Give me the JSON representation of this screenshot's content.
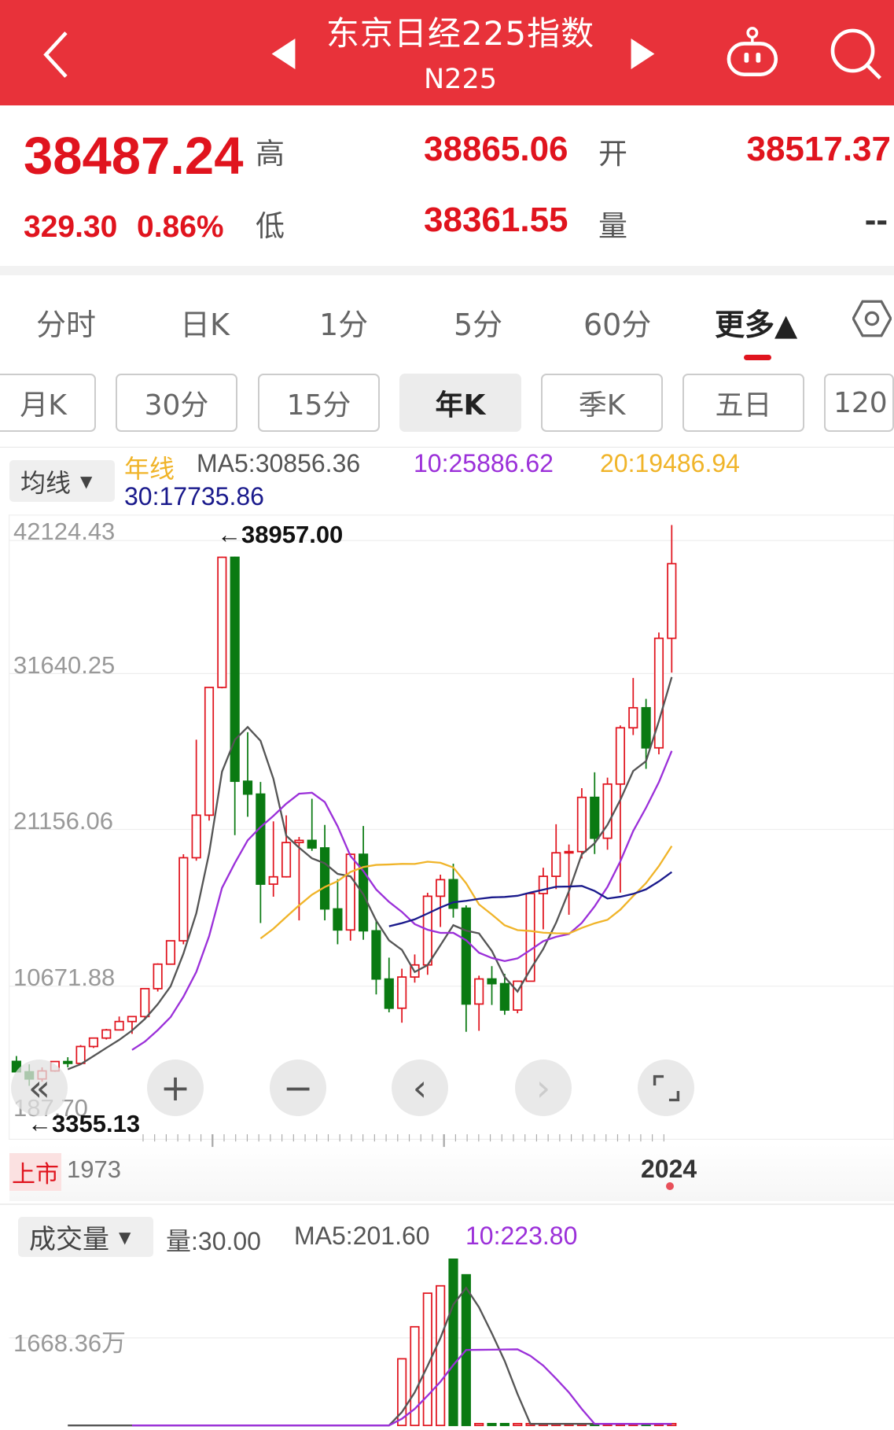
{
  "header": {
    "title": "东京日经225指数",
    "code": "N225"
  },
  "quote": {
    "price": "38487.24",
    "change": "329.30",
    "change_pct": "0.86%",
    "high_label": "高",
    "high": "38865.06",
    "open_label": "开",
    "open": "38517.37",
    "low_label": "低",
    "low": "38361.55",
    "vol_label": "量",
    "vol": "--"
  },
  "tabs": [
    {
      "label": "分时"
    },
    {
      "label": "日K"
    },
    {
      "label": "1分"
    },
    {
      "label": "5分"
    },
    {
      "label": "60分"
    },
    {
      "label": "更多▲"
    }
  ],
  "periods": [
    {
      "label": "月K"
    },
    {
      "label": "30分"
    },
    {
      "label": "15分"
    },
    {
      "label": "年K"
    },
    {
      "label": "季K"
    },
    {
      "label": "五日"
    },
    {
      "label": "120"
    }
  ],
  "ma_legend": {
    "selector": "均线",
    "type": "年线",
    "ma5": "MA5:30856.36",
    "ma10": "10:25886.62",
    "ma20": "20:19486.94",
    "ma30": "30:17735.86"
  },
  "colors": {
    "up": "#e0141e",
    "down": "#0a7a12",
    "ma5": "#555555",
    "ma10": "#9b30d9",
    "ma20": "#f0b429",
    "ma30": "#1a1a8c",
    "header": "#e8323a"
  },
  "price_axis": [
    "42124.43",
    "31640.25",
    "21156.06",
    "10671.88",
    "187.70"
  ],
  "annotations": {
    "max": "←38957.00",
    "min": "←3355.13"
  },
  "time_axis": {
    "listing_badge": "上市",
    "start": "1973",
    "end": "2024"
  },
  "volume": {
    "selector": "成交量",
    "vol": "量:30.00",
    "ma5": "MA5:201.60",
    "ma10": "10:223.80",
    "axis": "1668.36万"
  },
  "chart_data": {
    "type": "candlestick",
    "start_year": 1973,
    "ohlc": [
      [
        5000,
        5360,
        4300,
        4300
      ],
      [
        4300,
        4800,
        3355,
        3817
      ],
      [
        3817,
        4600,
        3630,
        4359
      ],
      [
        4359,
        4990,
        4300,
        4990
      ],
      [
        4990,
        5280,
        4600,
        4866
      ],
      [
        4866,
        6100,
        4860,
        6001
      ],
      [
        6001,
        6600,
        5900,
        6569
      ],
      [
        6569,
        7190,
        6470,
        7116
      ],
      [
        7116,
        8020,
        7100,
        7681
      ],
      [
        7681,
        8020,
        6850,
        8016
      ],
      [
        8016,
        9890,
        7800,
        9893
      ],
      [
        9893,
        11600,
        9700,
        11542
      ],
      [
        11542,
        13130,
        11500,
        13113
      ],
      [
        13113,
        18936,
        12880,
        18701
      ],
      [
        18701,
        26646,
        18500,
        21564
      ],
      [
        21564,
        30159,
        21200,
        30159
      ],
      [
        30159,
        38957,
        30100,
        38915
      ],
      [
        38915,
        38957,
        20221,
        23848
      ],
      [
        23848,
        27146,
        21456,
        22983
      ],
      [
        22983,
        23801,
        14309,
        16924
      ],
      [
        16924,
        21148,
        16078,
        17417
      ],
      [
        17417,
        21552,
        17369,
        19723
      ],
      [
        19723,
        20100,
        14485,
        19868
      ],
      [
        19868,
        22666,
        19161,
        19361
      ],
      [
        19361,
        20910,
        14488,
        15258
      ],
      [
        15258,
        17264,
        12879,
        13842
      ],
      [
        13842,
        19000,
        13122,
        18934
      ],
      [
        18934,
        20833,
        13182,
        13785
      ],
      [
        13785,
        14556,
        9504,
        10542
      ],
      [
        10542,
        11979,
        8303,
        8578
      ],
      [
        8578,
        11238,
        7603,
        10676
      ],
      [
        10676,
        12195,
        10299,
        11488
      ],
      [
        11488,
        16344,
        10825,
        16111
      ],
      [
        16111,
        17563,
        14045,
        17225
      ],
      [
        17225,
        18300,
        14669,
        15307
      ],
      [
        15307,
        15500,
        6994,
        8859
      ],
      [
        8859,
        10767,
        7054,
        10546
      ],
      [
        10546,
        11408,
        8796,
        10228
      ],
      [
        10228,
        10891,
        8135,
        8455
      ],
      [
        8455,
        10433,
        8238,
        10395
      ],
      [
        10395,
        16320,
        10398,
        16291
      ],
      [
        16291,
        18030,
        13885,
        17450
      ],
      [
        17450,
        20952,
        16592,
        19033
      ],
      [
        19033,
        19592,
        14864,
        19114
      ],
      [
        19114,
        23382,
        18650,
        22764
      ],
      [
        22764,
        24448,
        18948,
        20014
      ],
      [
        20014,
        24091,
        19241,
        23656
      ],
      [
        23656,
        27602,
        16358,
        27444
      ],
      [
        27444,
        30795,
        26954,
        28791
      ],
      [
        28791,
        29388,
        24681,
        26094
      ],
      [
        26094,
        33853,
        25661,
        33464
      ],
      [
        33464,
        41087,
        31156,
        38487
      ]
    ],
    "volume_wan": [
      0,
      0,
      0,
      0,
      0,
      0,
      0,
      0,
      0,
      0,
      0,
      0,
      0,
      0,
      0,
      0,
      0,
      0,
      0,
      0,
      0,
      0,
      0,
      0,
      0,
      0,
      0,
      0,
      0,
      0,
      1270,
      1880,
      2520,
      2660,
      3180,
      2870,
      30,
      30,
      30,
      30,
      30,
      30,
      30,
      30,
      30,
      30,
      30,
      30,
      30,
      30,
      30,
      30
    ],
    "ylim": [
      187.7,
      42124.43
    ]
  }
}
